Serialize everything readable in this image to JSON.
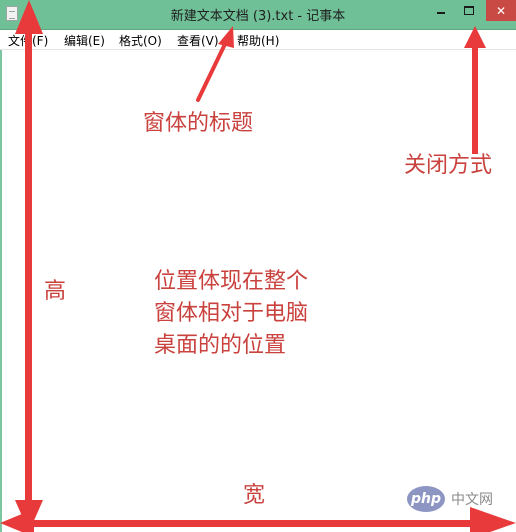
{
  "window": {
    "title": "新建文本文档 (3).txt - 记事本",
    "close_glyph": "✕"
  },
  "menu": {
    "items": [
      "文件(F)",
      "编辑(E)",
      "格式(O)",
      "查看(V)",
      "帮助(H)"
    ]
  },
  "annotations": {
    "title_label": "窗体的标题",
    "close_label": "关闭方式",
    "height_label": "高",
    "position_lines": [
      "位置体现在整个",
      "窗体相对于电脑",
      "桌面的的位置"
    ],
    "width_label": "宽"
  },
  "watermark": {
    "logo_text": "php",
    "site_text": "中文网"
  },
  "colors": {
    "titlebar": "#6fbf97",
    "close_button": "#c94a45",
    "annotation": "#c9423e",
    "arrow": "#e83a3a"
  },
  "icons": {
    "app": "notepad-icon",
    "minimize": "minimize-icon",
    "maximize": "maximize-icon",
    "close": "close-icon"
  }
}
